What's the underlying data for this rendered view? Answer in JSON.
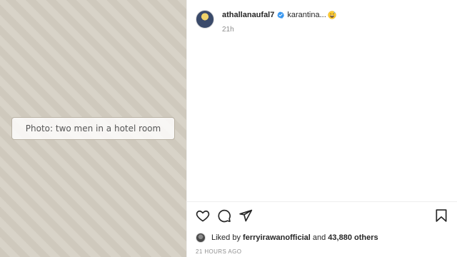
{
  "media": {
    "placeholder": "Photo: two men in a hotel room"
  },
  "header": {
    "username": "athallanaufal7",
    "caption": "karantina...",
    "verified_icon": "verified-badge-icon",
    "emoji_icon": "grinning-sweat-emoji",
    "time_ago": "21h"
  },
  "actions": {
    "like_icon": "heart-icon",
    "comment_icon": "comment-icon",
    "share_icon": "paper-plane-icon",
    "save_icon": "bookmark-icon"
  },
  "likes": {
    "prefix": "Liked by",
    "liker": "ferryirawanofficial",
    "connector": "and",
    "count_text": "43,880 others"
  },
  "posted": {
    "timestamp": "21 HOURS AGO"
  },
  "colors": {
    "verified_blue": "#3897f0",
    "text_primary": "#262626",
    "text_secondary": "#8e8e8e"
  }
}
